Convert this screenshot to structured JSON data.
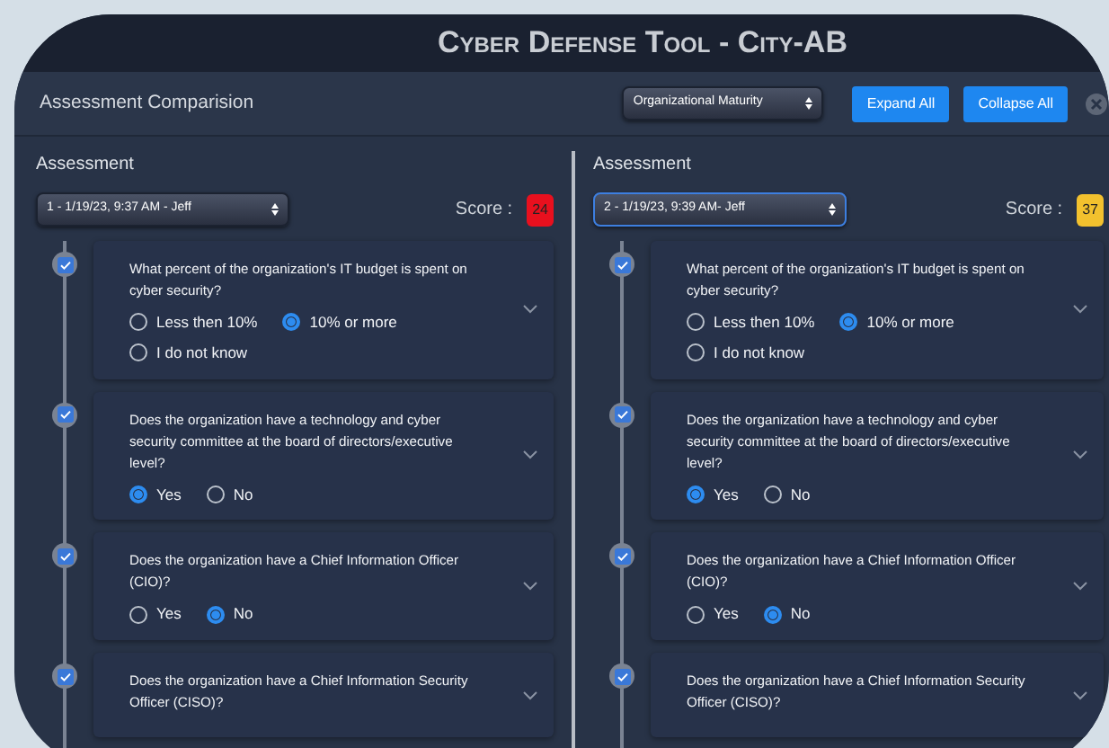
{
  "app_title": "Cyber Defense Tool - City-AB",
  "header": {
    "label": "Assessment Comparision",
    "category_select": "Organizational Maturity",
    "buttons": [
      "Expand All",
      "Collapse All"
    ]
  },
  "panels": [
    {
      "label": "Assessment",
      "select": "1 - 1/19/23, 9:37 AM - Jeff",
      "score_label": "Score :",
      "score": "24",
      "color": "#e8101e",
      "selected": false,
      "questions": [
        {
          "text": "What percent of the organization's IT budget is spent on cyber security?",
          "checked": true,
          "options": [
            {
              "label": "Less then 10%",
              "selected": false
            },
            {
              "label": "10% or more",
              "selected": true
            },
            {
              "label": "I do not know",
              "selected": false
            }
          ]
        },
        {
          "text": "Does the organization have a technology and cyber security committee at the board of directors/executive level?",
          "checked": true,
          "options": [
            {
              "label": "Yes",
              "selected": true
            },
            {
              "label": "No",
              "selected": false
            }
          ]
        },
        {
          "text": "Does the organization have a Chief Information Officer (CIO)?",
          "checked": true,
          "options": [
            {
              "label": "Yes",
              "selected": false
            },
            {
              "label": "No",
              "selected": true
            }
          ]
        },
        {
          "text": "Does the organization have a Chief Information Security Officer (CISO)?",
          "checked": true
        }
      ]
    },
    {
      "label": "Assessment",
      "select": "2 - 1/19/23, 9:39 AM- Jeff",
      "score_label": "Score :",
      "score": "37",
      "color": "#f2c12e",
      "selected": true,
      "questions": [
        {
          "text": "What percent of the organization's IT budget is spent on cyber security?",
          "checked": true,
          "options": [
            {
              "label": "Less then 10%",
              "selected": false
            },
            {
              "label": "10% or more",
              "selected": true
            },
            {
              "label": "I do not know",
              "selected": false
            }
          ]
        },
        {
          "text": "Does the organization have a technology and cyber security committee at the board of directors/executive level?",
          "checked": true,
          "options": [
            {
              "label": "Yes",
              "selected": true
            },
            {
              "label": "No",
              "selected": false
            }
          ]
        },
        {
          "text": "Does the organization have a Chief Information Officer (CIO)?",
          "checked": true,
          "options": [
            {
              "label": "Yes",
              "selected": false
            },
            {
              "label": "No",
              "selected": true
            }
          ]
        },
        {
          "text": "Does the organization have a Chief Information Security Officer (CISO)?",
          "checked": true
        }
      ]
    }
  ]
}
